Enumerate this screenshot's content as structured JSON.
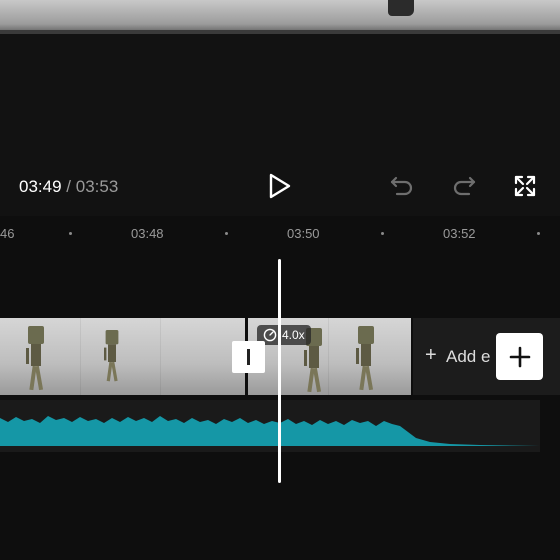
{
  "player": {
    "current_time": "03:49",
    "separator": "/",
    "total_time": "03:53"
  },
  "timeline": {
    "ruler": {
      "tick_labels": [
        "46",
        "03:48",
        "03:50",
        "03:52"
      ]
    },
    "video_track": {
      "speed_badge": "4.0x",
      "add_ending_label": "Add e"
    }
  },
  "icons": {
    "play": "play-icon",
    "undo": "undo-icon",
    "redo": "redo-icon",
    "fullscreen": "fullscreen-icon",
    "speed": "speed-icon",
    "add": "plus-icon"
  },
  "colors": {
    "background": "#121212",
    "waveform": "#1597a6",
    "accent": "#ffffff",
    "muted_text": "#9a9a9a"
  }
}
